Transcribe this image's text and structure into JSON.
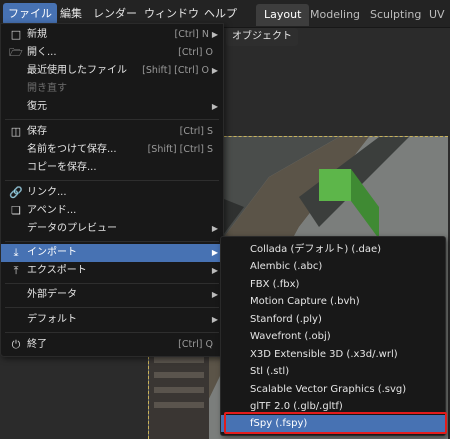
{
  "topbar": {
    "menus": [
      {
        "label": "ファイル",
        "active": true
      },
      {
        "label": "編集"
      },
      {
        "label": "レンダー"
      },
      {
        "label": "ウィンドウ"
      },
      {
        "label": "ヘルプ"
      }
    ],
    "workspace_tabs": [
      {
        "label": "Layout",
        "active": true
      },
      {
        "label": "Modeling"
      },
      {
        "label": "Sculpting"
      },
      {
        "label": "UV Ec"
      }
    ]
  },
  "viewport": {
    "object_menu": "オブジェクト"
  },
  "file_menu": {
    "items": [
      {
        "label": "新規",
        "shortcut": "[Ctrl] N",
        "icon": "new-file-icon",
        "arrow": true
      },
      {
        "label": "開く...",
        "shortcut": "[Ctrl] O",
        "icon": "folder-icon"
      },
      {
        "label": "最近使用したファイル",
        "shortcut": "[Shift] [Ctrl] O",
        "arrow": true
      },
      {
        "label": "開き直す",
        "disabled": true
      },
      {
        "label": "復元",
        "arrow": true
      },
      {
        "label": "保存",
        "shortcut": "[Ctrl] S",
        "icon": "save-icon"
      },
      {
        "label": "名前をつけて保存...",
        "shortcut": "[Shift] [Ctrl] S"
      },
      {
        "label": "コピーを保存..."
      },
      {
        "label": "リンク...",
        "icon": "link-icon"
      },
      {
        "label": "アペンド...",
        "icon": "append-icon"
      },
      {
        "label": "データのプレビュー",
        "arrow": true
      },
      {
        "label": "インポート",
        "icon": "import-icon",
        "arrow": true,
        "highlighted": true
      },
      {
        "label": "エクスポート",
        "icon": "export-icon",
        "arrow": true
      },
      {
        "label": "外部データ",
        "arrow": true
      },
      {
        "label": "デフォルト",
        "arrow": true
      },
      {
        "label": "終了",
        "shortcut": "[Ctrl] Q",
        "icon": "power-icon"
      }
    ]
  },
  "import_menu": {
    "items": [
      {
        "label": "Collada (デフォルト) (.dae)"
      },
      {
        "label": "Alembic (.abc)"
      },
      {
        "label": "FBX (.fbx)"
      },
      {
        "label": "Motion Capture (.bvh)"
      },
      {
        "label": "Stanford (.ply)"
      },
      {
        "label": "Wavefront (.obj)"
      },
      {
        "label": "X3D Extensible 3D (.x3d/.wrl)"
      },
      {
        "label": "Stl (.stl)"
      },
      {
        "label": "Scalable Vector Graphics (.svg)"
      },
      {
        "label": "glTF 2.0 (.glb/.gltf)"
      },
      {
        "label": "fSpy (.fspy)",
        "highlighted": true
      }
    ]
  },
  "colors": {
    "accent": "#4772b3",
    "menu_bg": "#181818",
    "annotation": "#e21c1c"
  }
}
